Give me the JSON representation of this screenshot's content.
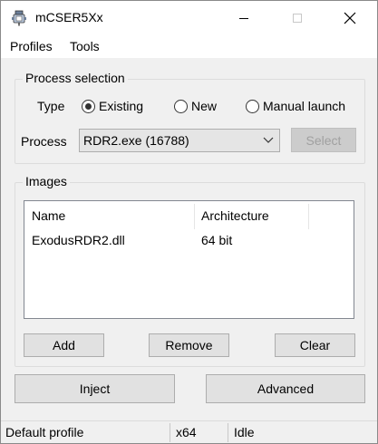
{
  "window": {
    "title": "mCSER5Xx",
    "app_icon": "injector-app-icon",
    "controls": {
      "minimize": "minimize-icon",
      "maximize": "maximize-icon",
      "close": "close-icon"
    }
  },
  "menu": {
    "items": [
      {
        "label": "Profiles"
      },
      {
        "label": "Tools"
      }
    ]
  },
  "process_selection": {
    "title": "Process selection",
    "type_label": "Type",
    "type_options": [
      {
        "label": "Existing",
        "checked": true
      },
      {
        "label": "New",
        "checked": false
      },
      {
        "label": "Manual launch",
        "checked": false
      }
    ],
    "process_label": "Process",
    "process_value": "RDR2.exe (16788)",
    "select_button": "Select"
  },
  "images": {
    "title": "Images",
    "columns": [
      "Name",
      "Architecture"
    ],
    "rows": [
      {
        "name": "ExodusRDR2.dll",
        "architecture": "64 bit"
      }
    ],
    "buttons": {
      "add": "Add",
      "remove": "Remove",
      "clear": "Clear"
    }
  },
  "actions": {
    "inject": "Inject",
    "advanced": "Advanced"
  },
  "status": {
    "profile": "Default profile",
    "arch": "x64",
    "state": "Idle"
  }
}
